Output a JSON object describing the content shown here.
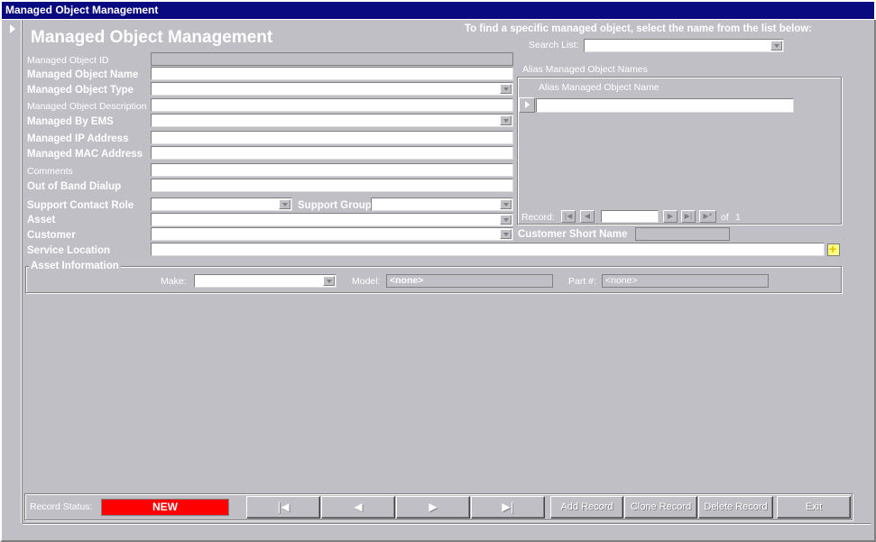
{
  "window": {
    "title": "Managed Object Management"
  },
  "form": {
    "title": "Managed Object Management",
    "search_hint": "To find a specific managed object, select the name from the list below:",
    "search_label": "Search List:",
    "search_value": ""
  },
  "fields": {
    "object_id": {
      "label": "Managed Object ID",
      "value": ""
    },
    "object_name": {
      "label": "Managed Object Name",
      "value": ""
    },
    "object_type": {
      "label": "Managed Object Type",
      "value": ""
    },
    "object_description": {
      "label": "Managed Object Description",
      "value": ""
    },
    "managed_by_ems": {
      "label": "Managed By EMS",
      "value": ""
    },
    "ip_address": {
      "label": "Managed IP Address",
      "value": ""
    },
    "mac_address": {
      "label": "Managed MAC Address",
      "value": ""
    },
    "comments": {
      "label": "Comments",
      "value": ""
    },
    "out_of_band_dialup": {
      "label": "Out of Band Dialup",
      "value": ""
    },
    "support_contact_role": {
      "label": "Support Contact Role",
      "value": ""
    },
    "support_group": {
      "label": "Support Group",
      "value": ""
    },
    "asset": {
      "label": "Asset",
      "value": ""
    },
    "customer": {
      "label": "Customer",
      "value": ""
    },
    "customer_short_name": {
      "label": "Customer Short Name",
      "value": ""
    },
    "service_location": {
      "label": "Service Location",
      "value": ""
    }
  },
  "alias_subform": {
    "title": "Alias Managed Object Names",
    "column_header": "Alias Managed Object Name",
    "record_label": "Record:",
    "record_value": "",
    "of_label": "of",
    "total": "1"
  },
  "asset_info": {
    "title": "Asset Information",
    "make_label": "Make:",
    "make_value": "",
    "model_label": "Model:",
    "model_value": "<none>",
    "part_label": "Part #:",
    "part_value": "<none>"
  },
  "footer": {
    "record_status_label": "Record Status:",
    "record_status_value": "NEW",
    "first_icon": "first-record-icon",
    "prev_icon": "previous-record-icon",
    "next_icon": "next-record-icon",
    "last_icon": "last-record-icon",
    "add_label": "Add Record",
    "clone_label": "Clone Record",
    "delete_label": "Delete Record",
    "exit_label": "Exit"
  },
  "colors": {
    "background": "#c0bfc6",
    "title_bar": "#0a0a80",
    "status_new": "#ff0000"
  }
}
